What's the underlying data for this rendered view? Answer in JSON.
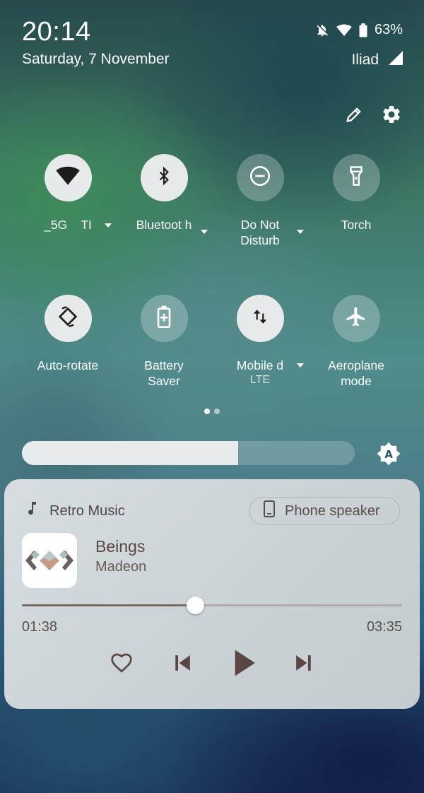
{
  "status_bar": {
    "time": "20:14",
    "date": "Saturday, 7 November",
    "battery_percent": "63%",
    "carrier": "Iliad",
    "icons": [
      "bell-off-icon",
      "wifi-icon",
      "battery-icon",
      "signal-icon"
    ]
  },
  "header_actions": [
    "edit-icon",
    "settings-icon"
  ],
  "tiles": [
    {
      "id": "wifi",
      "label": "_5G    TI",
      "icon": "wifi-icon",
      "active": true,
      "has_dropdown": true
    },
    {
      "id": "bluetooth",
      "label": "Bluetoot h",
      "icon": "bluetooth-icon",
      "active": true,
      "has_dropdown": true
    },
    {
      "id": "dnd",
      "label": "Do Not Disturb",
      "icon": "do-not-disturb-icon",
      "active": false,
      "has_dropdown": true
    },
    {
      "id": "torch",
      "label": "Torch",
      "icon": "torch-icon",
      "active": false,
      "has_dropdown": false
    },
    {
      "id": "autorotate",
      "label": "Auto-rotate",
      "icon": "auto-rotate-icon",
      "active": true,
      "has_dropdown": false
    },
    {
      "id": "battery_saver",
      "label": "Battery Saver",
      "icon": "battery-saver-icon",
      "active": false,
      "has_dropdown": false
    },
    {
      "id": "mobile_data",
      "label": "Mobile d",
      "sublabel": "LTE",
      "icon": "mobile-data-icon",
      "active": true,
      "has_dropdown": true
    },
    {
      "id": "airplane",
      "label": "Aeroplane mode",
      "icon": "airplane-icon",
      "active": false,
      "has_dropdown": false
    }
  ],
  "page_indicator": {
    "pages": 2,
    "current": 1
  },
  "brightness": {
    "level": 0.65,
    "auto_icon": "auto-brightness-icon"
  },
  "media": {
    "app_name": "Retro Music",
    "output_device": "Phone speaker",
    "title": "Beings",
    "artist": "Madeon",
    "elapsed": "01:38",
    "duration": "03:35",
    "progress": 0.456,
    "controls": [
      "heart-icon",
      "skip-previous-icon",
      "play-icon",
      "skip-next-icon"
    ]
  },
  "colors": {
    "tile_on": "#e6eaea",
    "tile_off": "rgba(255,255,255,0.25)",
    "media_card": "#d3d9dc",
    "media_text": "#5b4d4d"
  }
}
